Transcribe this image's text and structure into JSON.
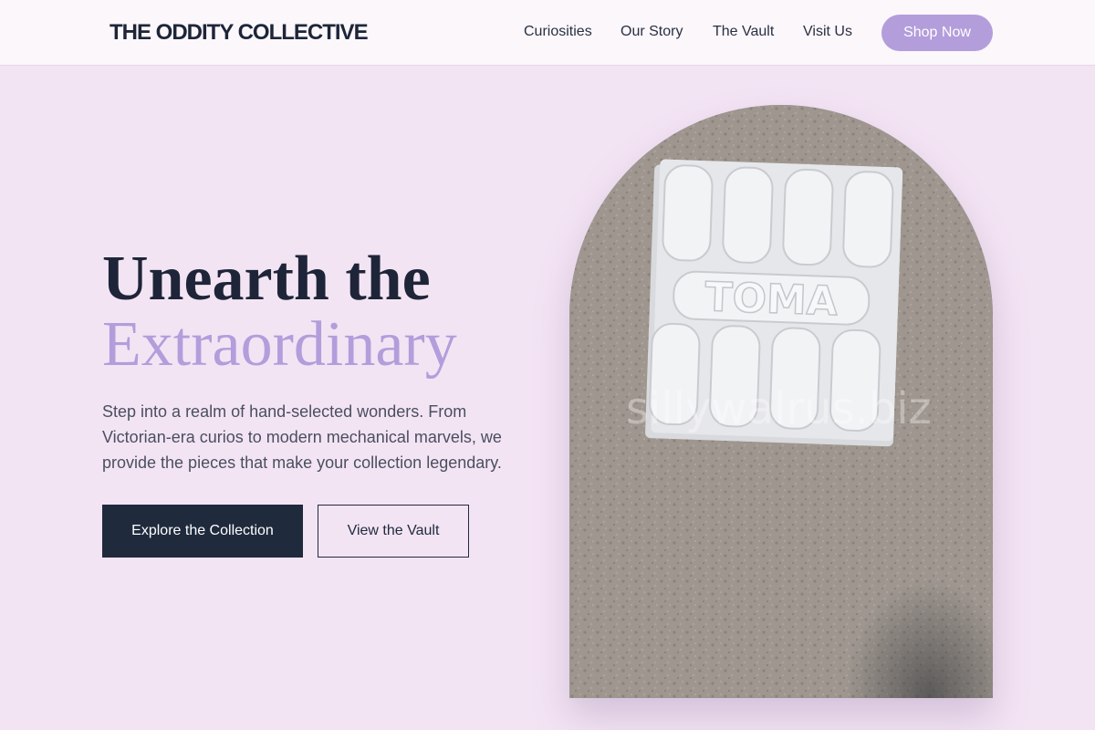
{
  "brand": {
    "logo": "THE ODDITY COLLECTIVE"
  },
  "nav": {
    "links": [
      "Curiosities",
      "Our Story",
      "The Vault",
      "Visit Us"
    ],
    "cta": "Shop Now"
  },
  "hero": {
    "title_line1": "Unearth the",
    "title_line2": "Extraordinary",
    "description": "Step into a realm of hand-selected wonders. From Victorian-era curios to modern mechanical marvels, we provide the pieces that make your collection legendary.",
    "primary_button": "Explore the Collection",
    "secondary_button": "View the Vault"
  },
  "image": {
    "plaque_text": "TOMA",
    "watermark": "sillywalrus.biz"
  },
  "colors": {
    "background": "#f3e4f4",
    "accent": "#b39ddb",
    "dark": "#1f2a3d"
  }
}
